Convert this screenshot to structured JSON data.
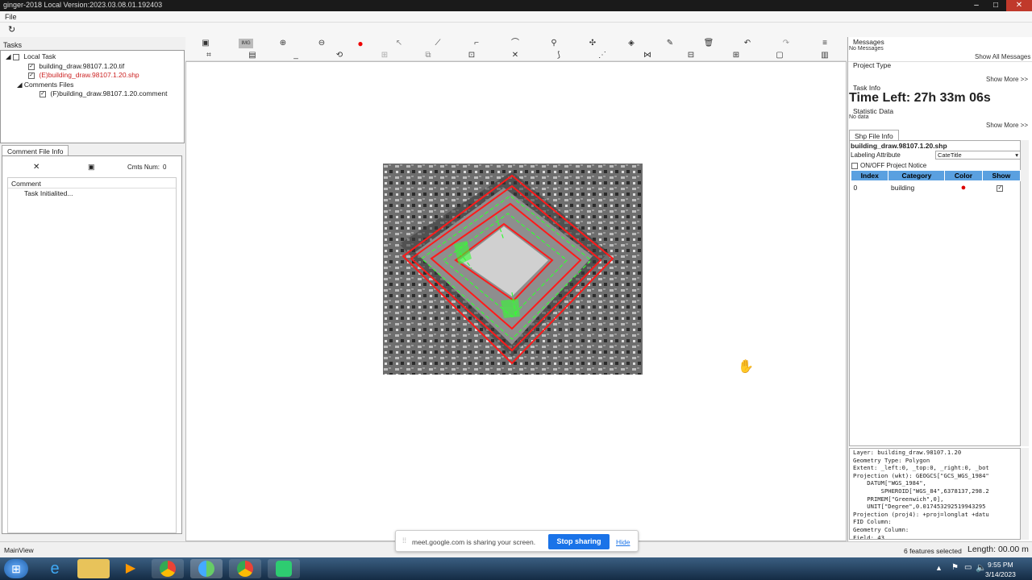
{
  "titlebar": {
    "title": "ginger-2018    Local Version:2023.03.08.01.192403",
    "minimize": "–",
    "maximize": "□",
    "close": "✕"
  },
  "menu": {
    "file": "File"
  },
  "tasks": {
    "header": "Tasks",
    "local_task": "Local Task",
    "files": [
      {
        "label": "building_draw.98107.1.20.tif",
        "color": "#222222"
      },
      {
        "label": "(E)building_draw.98107.1.20.shp",
        "color": "#cc2222"
      }
    ],
    "comments_folder": "Comments Files",
    "comment_file": "(F)building_draw.98107.1.20.comment"
  },
  "comment_panel": {
    "tab": "Comment File Info",
    "cmts_label": "Cmts Num:",
    "cmts_value": "0",
    "column": "Comment",
    "entry": "Task Initialited..."
  },
  "right": {
    "messages_label": "Messages",
    "no_messages": "No Messages",
    "show_all_messages": "Show All Messages",
    "project_type_label": "Project Type",
    "show_more_1": "Show More >>",
    "task_info_label": "Task Info",
    "time_left": "Time Left: 27h 33m 06s",
    "statistic_label": "Statistic Data",
    "no_data": "No data",
    "show_more_2": "Show More >>",
    "shp_tab": "Shp File Info",
    "shp_file": "building_draw.98107.1.20.shp",
    "labeling_attr_label": "Labeling Attribute",
    "labeling_attr_value": "CateTitle",
    "notice": "ON/OFF Project Notice",
    "table_headers": [
      "Index",
      "Category",
      "Color",
      "Show"
    ],
    "table_row": {
      "index": "0",
      "category": "building",
      "color": "#dd0000"
    },
    "info_lines": [
      "Layer: building_draw.98107.1.20",
      "Geometry Type: Polygon",
      "Extent: _left:0, _top:0, _right:0, _bot",
      "Projection (wkt): GEOGCS[\"GCS_WGS_1984\"",
      "    DATUM[\"WGS_1984\",",
      "        SPHEROID[\"WGS_84\",6378137,298.2",
      "    PRIMEM[\"Greenwich\",0],",
      "    UNIT[\"Degree\",0.017453292519943295",
      "Projection (proj4): +proj=longlat +datu",
      "FID Column:",
      "Geometry Column:",
      "Field: 43"
    ]
  },
  "status": {
    "mainview": "MainView",
    "features": "6 features selected",
    "length": "Length: 00.00 m"
  },
  "share_bar": {
    "text": "meet.google.com is sharing your screen.",
    "stop": "Stop sharing",
    "hide": "Hide"
  },
  "taskbar": {
    "time": "9:55 PM",
    "date": "3/14/2023"
  },
  "colors": {
    "polygon_red": "#ff1a1a",
    "polygon_green": "#33ff33",
    "accent_blue": "#1a73e8"
  },
  "icons": [
    "save-icon",
    "zoom-in-icon",
    "zoom-out-icon",
    "record-icon",
    "pointer-icon",
    "line-icon",
    "polygon-icon",
    "curve-icon",
    "pin-icon",
    "split-icon",
    "erase-icon",
    "edit-icon",
    "delete-icon",
    "undo-icon",
    "redo-icon",
    "menu-icon"
  ]
}
